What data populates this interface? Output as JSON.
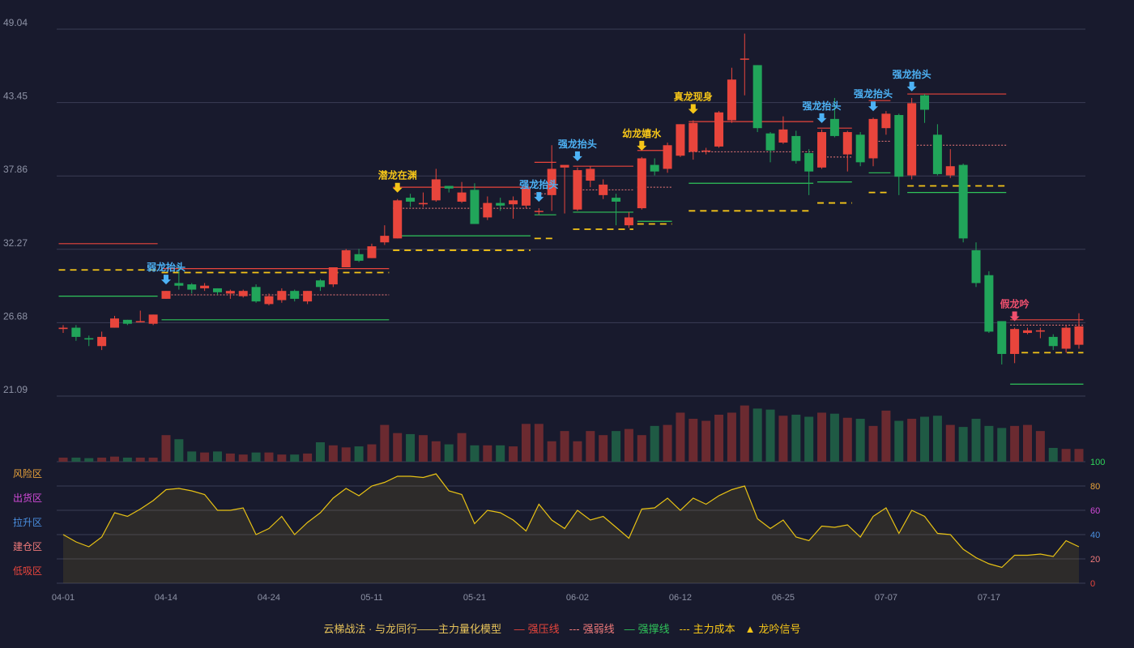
{
  "colors": {
    "background": "#181a2d",
    "grid": "#3a3d55",
    "up": "#e8453c",
    "down": "#21a55a",
    "pressure": "#e8453c",
    "weak": "#f07a7a",
    "support": "#2fc45a",
    "cost": "#f5c518",
    "signal_blue": "#4db2f5",
    "signal_gold": "#f5c518",
    "signal_red": "#f0506e",
    "indicator_line": "#e8c214",
    "tick_text": "#8e93a6"
  },
  "chart_data": [
    {
      "type": "candlestick",
      "ylim": [
        21.09,
        49.04
      ],
      "y_ticks": [
        "49.04",
        "43.45",
        "37.86",
        "32.27",
        "26.68",
        "21.09"
      ],
      "x_ticks": [
        {
          "i": 0,
          "label": "04-01"
        },
        {
          "i": 8,
          "label": "04-14"
        },
        {
          "i": 16,
          "label": "04-24"
        },
        {
          "i": 24,
          "label": "05-11"
        },
        {
          "i": 32,
          "label": "05-21"
        },
        {
          "i": 40,
          "label": "06-02"
        },
        {
          "i": 48,
          "label": "06-12"
        },
        {
          "i": 56,
          "label": "06-25"
        },
        {
          "i": 64,
          "label": "07-07"
        },
        {
          "i": 72,
          "label": "07-17"
        }
      ],
      "ohlc": [
        [
          26.2,
          26.3,
          25.9,
          26.5
        ],
        [
          26.3,
          25.6,
          25.3,
          26.5
        ],
        [
          25.5,
          25.4,
          24.9,
          25.7
        ],
        [
          24.9,
          25.6,
          24.6,
          26.0
        ],
        [
          26.3,
          27.0,
          26.3,
          27.2
        ],
        [
          26.9,
          26.6,
          26.5,
          26.9
        ],
        [
          26.8,
          26.8,
          26.7,
          27.6
        ],
        [
          26.6,
          27.3,
          26.5,
          27.3
        ],
        [
          28.5,
          29.1,
          28.5,
          29.1
        ],
        [
          29.7,
          29.5,
          29.2,
          31.1
        ],
        [
          29.6,
          29.2,
          28.9,
          29.7
        ],
        [
          29.3,
          29.5,
          29.1,
          29.7
        ],
        [
          29.3,
          29.0,
          28.8,
          29.3
        ],
        [
          28.9,
          29.1,
          28.5,
          29.2
        ],
        [
          28.7,
          29.1,
          28.6,
          29.2
        ],
        [
          29.4,
          28.3,
          28.2,
          29.6
        ],
        [
          28.1,
          28.7,
          28.0,
          28.9
        ],
        [
          28.4,
          29.1,
          28.2,
          29.3
        ],
        [
          29.1,
          28.5,
          28.3,
          29.2
        ],
        [
          28.3,
          29.1,
          28.1,
          29.1
        ],
        [
          29.9,
          29.4,
          29.1,
          30.0
        ],
        [
          29.6,
          30.9,
          29.4,
          30.9
        ],
        [
          30.9,
          32.2,
          30.9,
          32.3
        ],
        [
          31.9,
          31.4,
          31.3,
          32.3
        ],
        [
          31.6,
          32.5,
          31.6,
          32.7
        ],
        [
          32.8,
          33.3,
          32.6,
          34.1
        ],
        [
          33.1,
          36.0,
          33.1,
          36.1
        ],
        [
          36.2,
          35.9,
          35.5,
          36.5
        ],
        [
          35.7,
          35.8,
          35.5,
          36.6
        ],
        [
          36.0,
          37.6,
          35.9,
          38.4
        ],
        [
          37.1,
          36.9,
          36.6,
          37.1
        ],
        [
          35.9,
          36.6,
          35.8,
          37.4
        ],
        [
          36.8,
          34.2,
          34.2,
          37.3
        ],
        [
          34.7,
          35.8,
          34.5,
          36.3
        ],
        [
          35.8,
          35.6,
          35.2,
          36.2
        ],
        [
          35.7,
          36.0,
          34.6,
          36.3
        ],
        [
          35.6,
          36.9,
          35.4,
          37.5
        ],
        [
          35.2,
          35.2,
          34.9,
          35.4
        ],
        [
          36.4,
          38.4,
          35.2,
          40.2
        ],
        [
          38.5,
          38.7,
          35.0,
          38.5
        ],
        [
          35.3,
          38.3,
          35.2,
          38.5
        ],
        [
          37.5,
          38.4,
          37.0,
          38.6
        ],
        [
          36.4,
          37.2,
          36.1,
          37.6
        ],
        [
          36.2,
          35.9,
          34.1,
          36.5
        ],
        [
          34.1,
          34.7,
          33.9,
          35.1
        ],
        [
          35.4,
          39.2,
          35.3,
          39.3
        ],
        [
          38.7,
          38.2,
          37.9,
          39.2
        ],
        [
          38.4,
          40.2,
          38.1,
          40.4
        ],
        [
          39.4,
          41.8,
          39.3,
          41.8
        ],
        [
          39.7,
          41.9,
          39.1,
          42.1
        ],
        [
          39.8,
          39.8,
          39.5,
          40.0
        ],
        [
          40.1,
          42.7,
          40.0,
          42.8
        ],
        [
          42.1,
          45.2,
          41.9,
          46.1
        ],
        [
          46.8,
          46.8,
          44.0,
          48.7
        ],
        [
          46.3,
          41.5,
          41.2,
          46.3
        ],
        [
          41.1,
          39.8,
          38.9,
          41.2
        ],
        [
          40.4,
          41.4,
          40.3,
          42.4
        ],
        [
          40.9,
          39.0,
          38.8,
          41.3
        ],
        [
          39.6,
          38.2,
          36.4,
          39.9
        ],
        [
          38.5,
          41.2,
          38.4,
          41.4
        ],
        [
          42.2,
          40.9,
          40.8,
          43.8
        ],
        [
          39.5,
          41.2,
          38.2,
          41.3
        ],
        [
          41.0,
          38.9,
          38.6,
          41.2
        ],
        [
          39.2,
          42.2,
          38.6,
          42.3
        ],
        [
          41.5,
          42.6,
          41.0,
          42.8
        ],
        [
          42.5,
          37.8,
          36.4,
          42.6
        ],
        [
          37.9,
          43.4,
          37.6,
          43.8
        ],
        [
          44.0,
          42.9,
          41.9,
          44.1
        ],
        [
          41.0,
          38.0,
          37.9,
          41.8
        ],
        [
          37.9,
          38.6,
          37.7,
          39.9
        ],
        [
          38.7,
          33.1,
          32.8,
          38.8
        ],
        [
          32.2,
          29.7,
          29.4,
          32.8
        ],
        [
          30.3,
          26.0,
          25.9,
          30.6
        ],
        [
          26.8,
          24.3,
          23.5,
          26.8
        ],
        [
          24.3,
          26.2,
          23.6,
          26.3
        ],
        [
          25.9,
          26.1,
          25.8,
          26.3
        ],
        [
          26.0,
          26.1,
          25.5,
          26.3
        ],
        [
          25.6,
          24.9,
          24.6,
          25.8
        ],
        [
          24.7,
          26.3,
          24.4,
          26.5
        ],
        [
          25.0,
          26.4,
          24.7,
          27.4
        ]
      ],
      "volume": [
        8,
        8,
        7,
        8,
        10,
        8,
        8,
        8,
        52,
        44,
        20,
        18,
        20,
        16,
        14,
        18,
        18,
        14,
        14,
        16,
        38,
        32,
        28,
        30,
        34,
        72,
        56,
        54,
        52,
        40,
        34,
        56,
        32,
        32,
        32,
        30,
        74,
        74,
        40,
        60,
        40,
        60,
        52,
        60,
        64,
        52,
        70,
        72,
        96,
        84,
        80,
        92,
        96,
        110,
        104,
        102,
        90,
        92,
        88,
        96,
        94,
        86,
        84,
        70,
        100,
        80,
        84,
        88,
        90,
        72,
        68,
        84,
        70,
        66,
        70,
        72,
        60,
        27,
        25,
        25
      ],
      "volume_max": 130,
      "levels": [
        {
          "kind": "pressure",
          "from": 0,
          "to": 7,
          "value": 32.7
        },
        {
          "kind": "cost",
          "from": 0,
          "to": 7,
          "value": 30.7
        },
        {
          "kind": "support",
          "from": 0,
          "to": 7,
          "value": 28.7
        },
        {
          "kind": "pressure",
          "from": 8,
          "to": 25,
          "value": 30.8
        },
        {
          "kind": "cost",
          "from": 8,
          "to": 25,
          "value": 30.5
        },
        {
          "kind": "weak",
          "from": 8,
          "to": 25,
          "value": 28.8
        },
        {
          "kind": "support",
          "from": 8,
          "to": 25,
          "value": 26.9
        },
        {
          "kind": "pressure",
          "from": 26,
          "to": 36,
          "value": 37.0
        },
        {
          "kind": "weak",
          "from": 26,
          "to": 36,
          "value": 35.4
        },
        {
          "kind": "support",
          "from": 26,
          "to": 36,
          "value": 33.3
        },
        {
          "kind": "cost",
          "from": 26,
          "to": 36,
          "value": 32.2
        },
        {
          "kind": "pressure",
          "from": 37,
          "to": 38,
          "value": 38.9
        },
        {
          "kind": "weak",
          "from": 37,
          "to": 38,
          "value": 36.5
        },
        {
          "kind": "support",
          "from": 37,
          "to": 38,
          "value": 34.9
        },
        {
          "kind": "cost",
          "from": 37,
          "to": 38,
          "value": 33.1
        },
        {
          "kind": "pressure",
          "from": 40,
          "to": 44,
          "value": 38.6
        },
        {
          "kind": "weak",
          "from": 40,
          "to": 44,
          "value": 36.8
        },
        {
          "kind": "support",
          "from": 40,
          "to": 44,
          "value": 35.1
        },
        {
          "kind": "cost",
          "from": 40,
          "to": 44,
          "value": 33.8
        },
        {
          "kind": "pressure",
          "from": 45,
          "to": 47,
          "value": 39.8
        },
        {
          "kind": "weak",
          "from": 45,
          "to": 47,
          "value": 37.0
        },
        {
          "kind": "support",
          "from": 45,
          "to": 47,
          "value": 34.4
        },
        {
          "kind": "cost",
          "from": 45,
          "to": 47,
          "value": 34.2
        },
        {
          "kind": "pressure",
          "from": 49,
          "to": 58,
          "value": 42.0
        },
        {
          "kind": "weak",
          "from": 49,
          "to": 58,
          "value": 39.7
        },
        {
          "kind": "support",
          "from": 49,
          "to": 58,
          "value": 37.3
        },
        {
          "kind": "cost",
          "from": 49,
          "to": 58,
          "value": 35.2
        },
        {
          "kind": "pressure",
          "from": 59,
          "to": 61,
          "value": 41.5
        },
        {
          "kind": "weak",
          "from": 59,
          "to": 61,
          "value": 39.3
        },
        {
          "kind": "support",
          "from": 59,
          "to": 61,
          "value": 37.4
        },
        {
          "kind": "cost",
          "from": 59,
          "to": 61,
          "value": 35.8
        },
        {
          "kind": "pressure",
          "from": 63,
          "to": 64,
          "value": 43.6
        },
        {
          "kind": "weak",
          "from": 63,
          "to": 64,
          "value": 40.5
        },
        {
          "kind": "support",
          "from": 63,
          "to": 64,
          "value": 38.1
        },
        {
          "kind": "cost",
          "from": 63,
          "to": 64,
          "value": 36.6
        },
        {
          "kind": "pressure",
          "from": 66,
          "to": 73,
          "value": 44.1
        },
        {
          "kind": "weak",
          "from": 66,
          "to": 73,
          "value": 40.2
        },
        {
          "kind": "support",
          "from": 66,
          "to": 73,
          "value": 36.6
        },
        {
          "kind": "cost",
          "from": 66,
          "to": 73,
          "value": 37.1
        },
        {
          "kind": "pressure",
          "from": 74,
          "to": 79,
          "value": 26.9
        },
        {
          "kind": "weak",
          "from": 74,
          "to": 79,
          "value": 26.5
        },
        {
          "kind": "cost",
          "from": 74,
          "to": 79,
          "value": 24.4
        },
        {
          "kind": "support",
          "from": 74,
          "to": 79,
          "value": 22.0
        }
      ],
      "signals": [
        {
          "i": 8,
          "label": "弱龙抬头",
          "color": "signal_blue"
        },
        {
          "i": 26,
          "label": "潜龙在渊",
          "color": "signal_gold"
        },
        {
          "i": 37,
          "label": "强龙抬头",
          "color": "signal_blue"
        },
        {
          "i": 40,
          "label": "强龙抬头",
          "color": "signal_blue"
        },
        {
          "i": 45,
          "label": "幼龙嬉水",
          "color": "signal_gold"
        },
        {
          "i": 49,
          "label": "真龙现身",
          "color": "signal_gold"
        },
        {
          "i": 59,
          "label": "强龙抬头",
          "color": "signal_blue"
        },
        {
          "i": 63,
          "label": "强龙抬头",
          "color": "signal_blue"
        },
        {
          "i": 66,
          "label": "强龙抬头",
          "color": "signal_blue"
        },
        {
          "i": 74,
          "label": "假龙吟",
          "color": "signal_red"
        }
      ]
    },
    {
      "type": "area",
      "ylim": [
        0,
        100
      ],
      "right_ticks": [
        {
          "value": 100,
          "label": "100",
          "color": "#2fd45a"
        },
        {
          "value": 80,
          "label": "80",
          "color": "#e8a23a"
        },
        {
          "value": 60,
          "label": "60",
          "color": "#d24ad9"
        },
        {
          "value": 40,
          "label": "40",
          "color": "#4a8fe0"
        },
        {
          "value": 20,
          "label": "20",
          "color": "#f07a7a"
        },
        {
          "value": 0,
          "label": "0",
          "color": "#e8453c"
        }
      ],
      "zones": [
        {
          "value": 80,
          "label": "风险区",
          "color": "#e8a23a"
        },
        {
          "value": 60,
          "label": "出货区",
          "color": "#d24ad9"
        },
        {
          "value": 40,
          "label": "拉升区",
          "color": "#4a8fe0"
        },
        {
          "value": 20,
          "label": "建仓区",
          "color": "#f07a7a"
        },
        {
          "value": 0,
          "label": "低吸区",
          "color": "#e8453c"
        }
      ],
      "values": [
        40,
        34,
        30,
        38,
        58,
        55,
        61,
        68,
        77,
        78,
        76,
        73,
        60,
        60,
        62,
        40,
        45,
        55,
        40,
        50,
        58,
        70,
        78,
        72,
        80,
        83,
        88,
        88,
        87,
        90,
        76,
        73,
        49,
        60,
        58,
        52,
        43,
        65,
        52,
        45,
        60,
        52,
        55,
        46,
        37,
        61,
        62,
        70,
        60,
        70,
        65,
        72,
        77,
        80,
        53,
        45,
        52,
        38,
        35,
        47,
        46,
        48,
        38,
        55,
        62,
        41,
        60,
        55,
        41,
        40,
        28,
        21,
        16,
        13,
        23,
        23,
        24,
        22,
        35,
        30
      ]
    }
  ],
  "legend": {
    "title": "云梯战法 · 与龙同行——主力量化模型",
    "items": [
      {
        "symbol": "—",
        "label": "强压线",
        "color": "#e8453c"
      },
      {
        "symbol": "---",
        "label": "强弱线",
        "color": "#f07a7a"
      },
      {
        "symbol": "—",
        "label": "强撑线",
        "color": "#2fc45a"
      },
      {
        "symbol": "---",
        "label": "主力成本",
        "color": "#f5c518"
      },
      {
        "symbol": "▲",
        "label": "龙吟信号",
        "color": "#f5c518"
      }
    ]
  }
}
